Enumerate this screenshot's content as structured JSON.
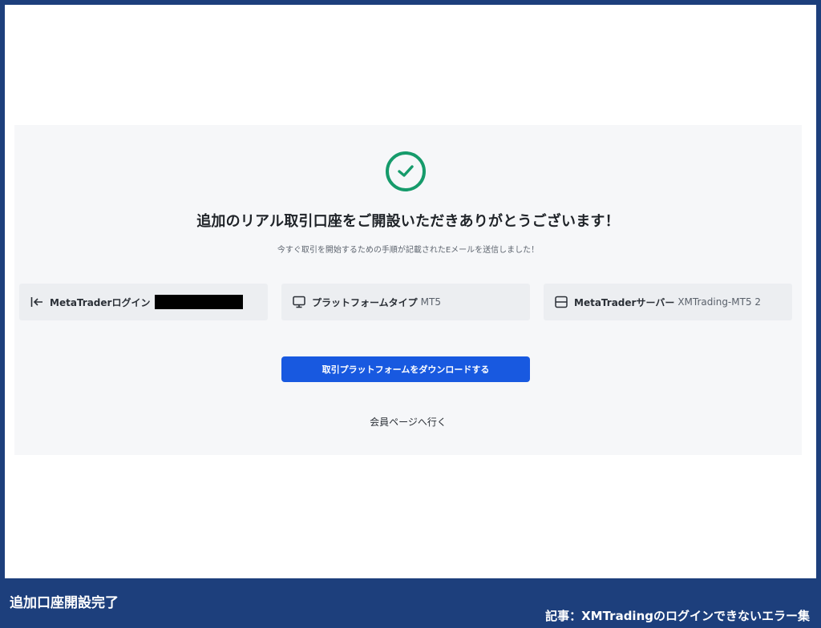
{
  "panel": {
    "heading": "追加のリアル取引口座をご開設いただきありがとうございます！",
    "subtext": "今すぐ取引を開始するための手順が記載されたEメールを送信しました！"
  },
  "cards": {
    "login": {
      "icon": "login-arrow-icon",
      "label": "MetaTraderログイン",
      "value_redacted": true
    },
    "platform": {
      "icon": "monitor-icon",
      "label": "プラットフォームタイプ",
      "value": "MT5"
    },
    "server": {
      "icon": "server-icon",
      "label": "MetaTraderサーバー",
      "value": "XMTrading-MT5 2"
    }
  },
  "actions": {
    "download_label": "取引プラットフォームをダウンロードする",
    "member_link_label": "会員ページへ行く"
  },
  "captions": {
    "left": "追加口座開設完了",
    "right": "記事：XMTradingのログインできないエラー集"
  },
  "colors": {
    "frame": "#1d3f7c",
    "accent": "#1859e0",
    "success": "#169b6b"
  }
}
